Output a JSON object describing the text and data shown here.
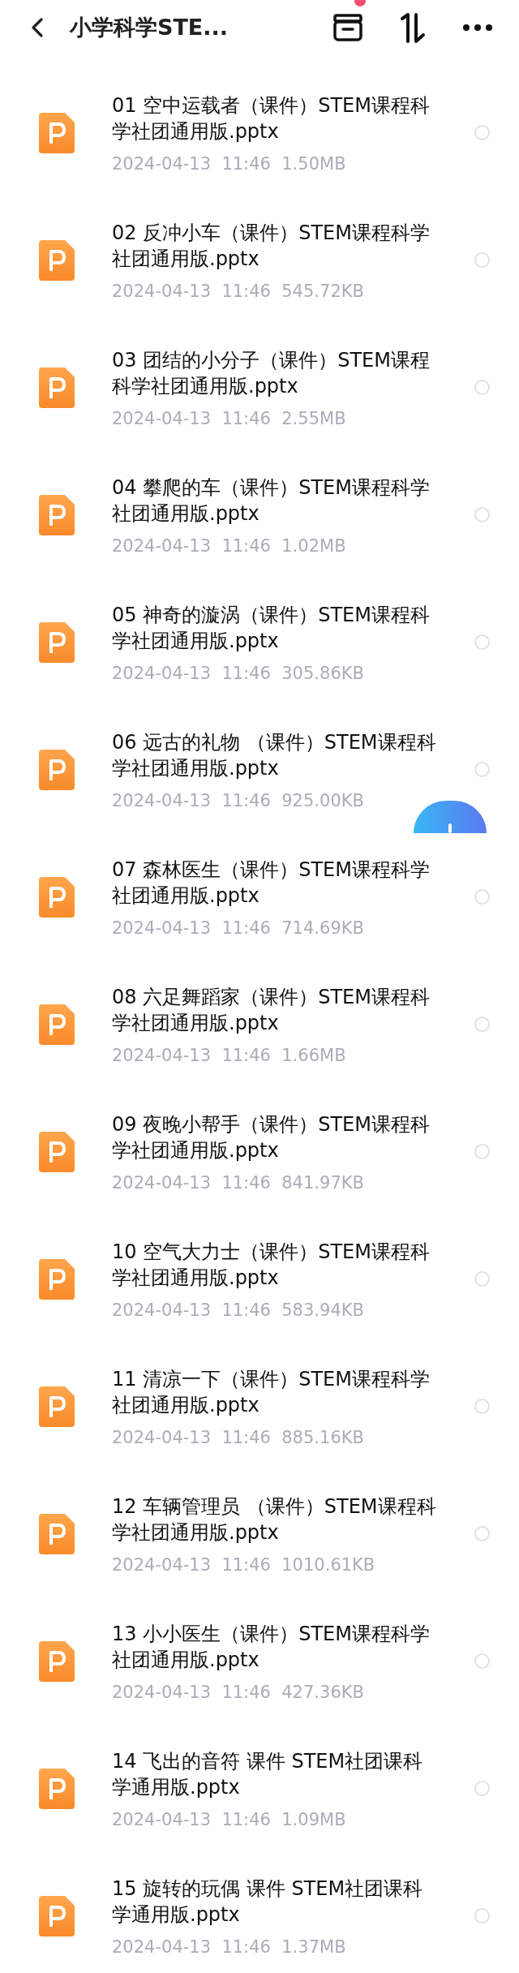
{
  "header": {
    "title": "小学科学STE..."
  },
  "files": [
    {
      "name": "01 空中运载者（课件）STEM课程科学社团通用版.pptx",
      "date": "2024-04-13",
      "time": "11:46",
      "size": "1.50MB",
      "selected": false
    },
    {
      "name": "02 反冲小车（课件）STEM课程科学社团通用版.pptx",
      "date": "2024-04-13",
      "time": "11:46",
      "size": "545.72KB",
      "selected": false
    },
    {
      "name": "03 团结的小分子（课件）STEM课程科学社团通用版.pptx",
      "date": "2024-04-13",
      "time": "11:46",
      "size": "2.55MB",
      "selected": false
    },
    {
      "name": "04 攀爬的车（课件）STEM课程科学社团通用版.pptx",
      "date": "2024-04-13",
      "time": "11:46",
      "size": "1.02MB",
      "selected": false
    },
    {
      "name": "05 神奇的漩涡（课件）STEM课程科学社团通用版.pptx",
      "date": "2024-04-13",
      "time": "11:46",
      "size": "305.86KB",
      "selected": false
    },
    {
      "name": "06  远古的礼物 （课件）STEM课程科学社团通用版.pptx",
      "date": "2024-04-13",
      "time": "11:46",
      "size": "925.00KB",
      "selected": false
    },
    {
      "name": "07 森林医生（课件）STEM课程科学社团通用版.pptx",
      "date": "2024-04-13",
      "time": "11:46",
      "size": "714.69KB",
      "selected": false
    },
    {
      "name": "08 六足舞蹈家（课件）STEM课程科学社团通用版.pptx",
      "date": "2024-04-13",
      "time": "11:46",
      "size": "1.66MB",
      "selected": false
    },
    {
      "name": "09 夜晚小帮手（课件）STEM课程科学社团通用版.pptx",
      "date": "2024-04-13",
      "time": "11:46",
      "size": "841.97KB",
      "selected": false
    },
    {
      "name": "10 空气大力士（课件）STEM课程科学社团通用版.pptx",
      "date": "2024-04-13",
      "time": "11:46",
      "size": "583.94KB",
      "selected": false
    },
    {
      "name": "11 清凉一下（课件）STEM课程科学社团通用版.pptx",
      "date": "2024-04-13",
      "time": "11:46",
      "size": "885.16KB",
      "selected": false
    },
    {
      "name": "12 车辆管理员 （课件）STEM课程科学社团通用版.pptx",
      "date": "2024-04-13",
      "time": "11:46",
      "size": "1010.61KB",
      "selected": false
    },
    {
      "name": "13 小小医生（课件）STEM课程科学社团通用版.pptx",
      "date": "2024-04-13",
      "time": "11:46",
      "size": "427.36KB",
      "selected": false
    },
    {
      "name": "14 飞出的音符 课件  STEM社团课科学通用版.pptx",
      "date": "2024-04-13",
      "time": "11:46",
      "size": "1.09MB",
      "selected": false
    },
    {
      "name": "15 旋转的玩偶 课件  STEM社团课科学通用版.pptx",
      "date": "2024-04-13",
      "time": "11:46",
      "size": "1.37MB",
      "selected": false
    }
  ]
}
